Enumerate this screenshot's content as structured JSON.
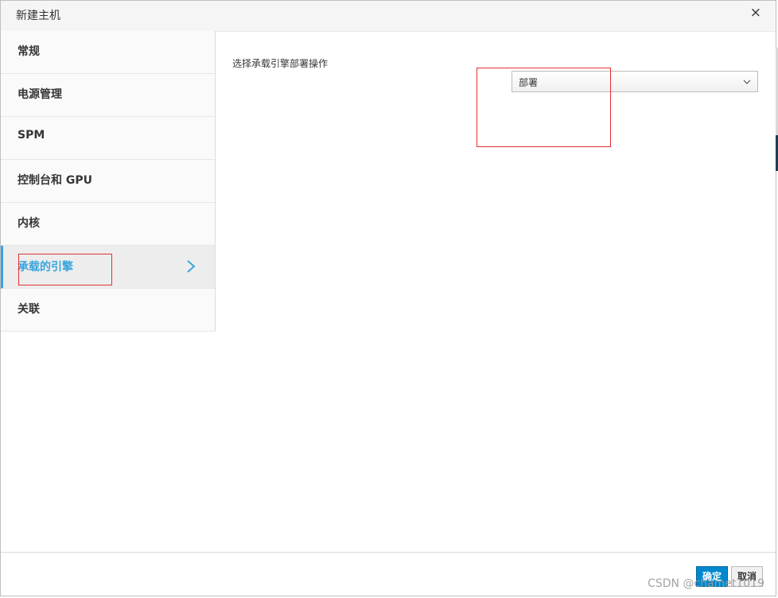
{
  "dialog": {
    "title": "新建主机",
    "close_glyph": "×"
  },
  "sidebar": {
    "items": [
      {
        "label": "常规"
      },
      {
        "label": "电源管理"
      },
      {
        "label": "SPM"
      },
      {
        "label": "控制台和 GPU"
      },
      {
        "label": "内核"
      },
      {
        "label": "承载的引擎"
      },
      {
        "label": "关联"
      }
    ],
    "active_index": 5,
    "active_icon": "chevron-right-icon"
  },
  "main": {
    "hosted_engine_label": "选择承载引擎部署操作",
    "deploy_select": {
      "selected": "部署",
      "icon": "chevron-down-icon"
    }
  },
  "footer": {
    "ok_label": "确定",
    "cancel_label": "取消"
  },
  "watermark": "CSDN @chamet1019",
  "colors": {
    "accent": "#39a5dc",
    "primary_button": "#0088ce",
    "annotation_red": "#e53030"
  }
}
